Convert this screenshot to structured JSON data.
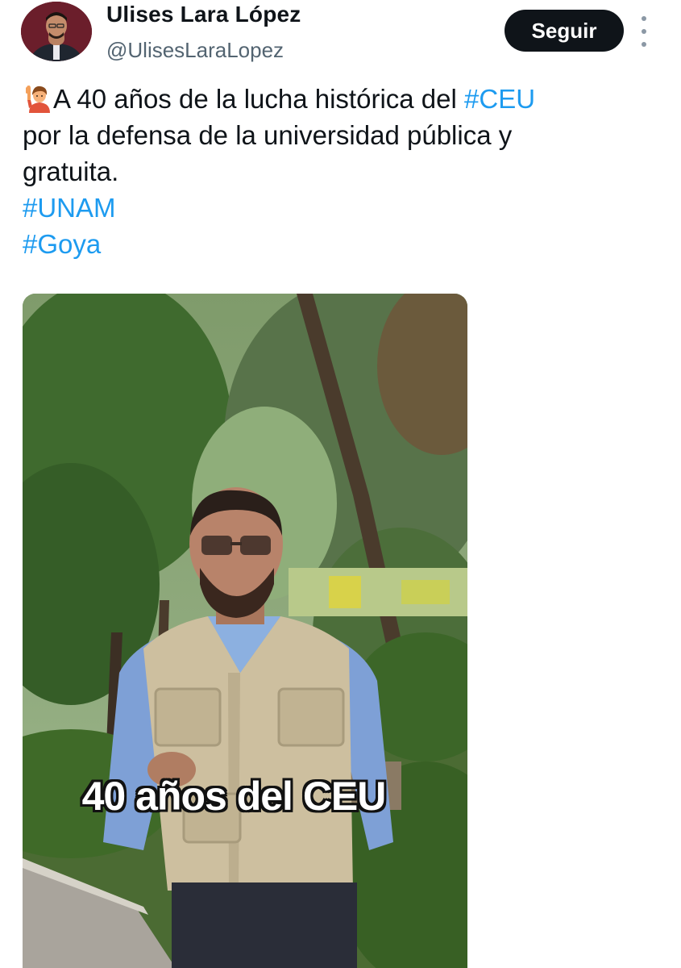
{
  "author": {
    "display_name": "Ulises Lara López",
    "handle": "@UlisesLaraLopez",
    "avatar_icon": "profile-photo"
  },
  "actions": {
    "follow_label": "Seguir",
    "more_icon": "vertical-ellipsis-icon"
  },
  "tweet": {
    "emoji_icon": "person-raising-hand-emoji",
    "line1_text": "A 40 años de la lucha histórica del ",
    "line1_hashtag": "#CEU",
    "line2_text": "por la defensa de la universidad pública y",
    "line3_text": "gratuita.",
    "hashtag2": "#UNAM",
    "hashtag3": "#Goya"
  },
  "media": {
    "caption": "40 años del CEU"
  },
  "colors": {
    "link": "#1d9bf0",
    "button_bg": "#0f1419",
    "secondary_text": "#536471"
  }
}
